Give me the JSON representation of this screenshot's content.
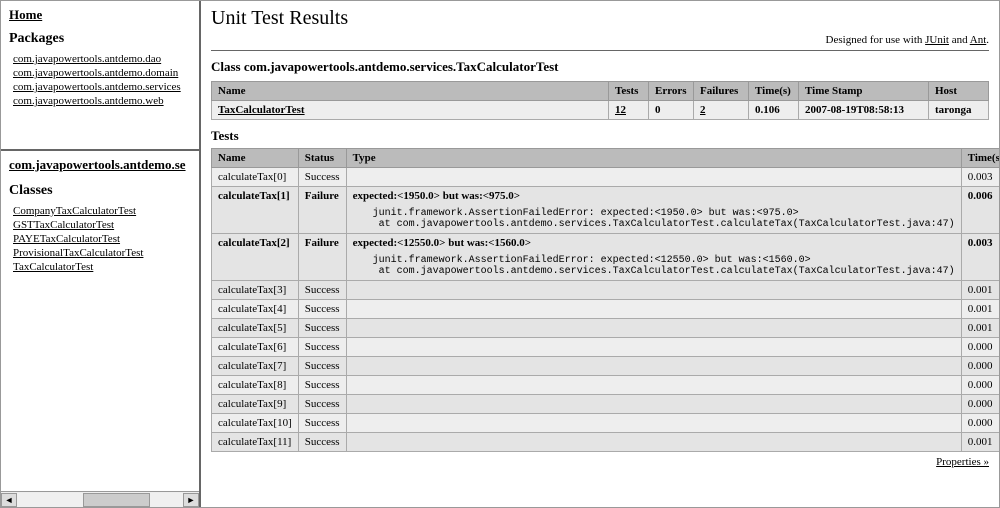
{
  "leftTop": {
    "home": "Home",
    "packagesHeading": "Packages",
    "packages": [
      "com.javapowertools.antdemo.dao",
      "com.javapowertools.antdemo.domain",
      "com.javapowertools.antdemo.services",
      "com.javapowertools.antdemo.web"
    ]
  },
  "leftBottom": {
    "currentPackage": "com.javapowertools.antdemo.se",
    "classesHeading": "Classes",
    "classes": [
      "CompanyTaxCalculatorTest",
      "GSTTaxCalculatorTest",
      "PAYETaxCalculatorTest",
      "ProvisionalTaxCalculatorTest",
      "TaxCalculatorTest"
    ]
  },
  "main": {
    "title": "Unit Test Results",
    "designedPrefix": "Designed for use with ",
    "junit": "JUnit",
    "and": " and ",
    "ant": "Ant",
    "dot": ".",
    "classHeading": "Class com.javapowertools.antdemo.services.TaxCalculatorTest",
    "summaryHeaders": {
      "name": "Name",
      "tests": "Tests",
      "errors": "Errors",
      "failures": "Failures",
      "time": "Time(s)",
      "timestamp": "Time Stamp",
      "host": "Host"
    },
    "summaryRow": {
      "name": "TaxCalculatorTest",
      "tests": "12",
      "errors": "0",
      "failures": "2",
      "time": "0.106",
      "timestamp": "2007-08-19T08:58:13",
      "host": "taronga"
    },
    "testsHeading": "Tests",
    "testsHeaders": {
      "name": "Name",
      "status": "Status",
      "type": "Type",
      "time": "Time(s)"
    },
    "tests": [
      {
        "name": "calculateTax[0]",
        "status": "Success",
        "type": "",
        "trace": "",
        "time": "0.003",
        "fail": false
      },
      {
        "name": "calculateTax[1]",
        "status": "Failure",
        "type": "expected:<1950.0> but was:<975.0>",
        "trace": "junit.framework.AssertionFailedError: expected:<1950.0> but was:<975.0>\n at com.javapowertools.antdemo.services.TaxCalculatorTest.calculateTax(TaxCalculatorTest.java:47)",
        "time": "0.006",
        "fail": true
      },
      {
        "name": "calculateTax[2]",
        "status": "Failure",
        "type": "expected:<12550.0> but was:<1560.0>",
        "trace": "junit.framework.AssertionFailedError: expected:<12550.0> but was:<1560.0>\n at com.javapowertools.antdemo.services.TaxCalculatorTest.calculateTax(TaxCalculatorTest.java:47)",
        "time": "0.003",
        "fail": true
      },
      {
        "name": "calculateTax[3]",
        "status": "Success",
        "type": "",
        "trace": "",
        "time": "0.001",
        "fail": false
      },
      {
        "name": "calculateTax[4]",
        "status": "Success",
        "type": "",
        "trace": "",
        "time": "0.001",
        "fail": false
      },
      {
        "name": "calculateTax[5]",
        "status": "Success",
        "type": "",
        "trace": "",
        "time": "0.001",
        "fail": false
      },
      {
        "name": "calculateTax[6]",
        "status": "Success",
        "type": "",
        "trace": "",
        "time": "0.000",
        "fail": false
      },
      {
        "name": "calculateTax[7]",
        "status": "Success",
        "type": "",
        "trace": "",
        "time": "0.000",
        "fail": false
      },
      {
        "name": "calculateTax[8]",
        "status": "Success",
        "type": "",
        "trace": "",
        "time": "0.000",
        "fail": false
      },
      {
        "name": "calculateTax[9]",
        "status": "Success",
        "type": "",
        "trace": "",
        "time": "0.000",
        "fail": false
      },
      {
        "name": "calculateTax[10]",
        "status": "Success",
        "type": "",
        "trace": "",
        "time": "0.000",
        "fail": false
      },
      {
        "name": "calculateTax[11]",
        "status": "Success",
        "type": "",
        "trace": "",
        "time": "0.001",
        "fail": false
      }
    ],
    "propertiesLink": "Properties »"
  }
}
